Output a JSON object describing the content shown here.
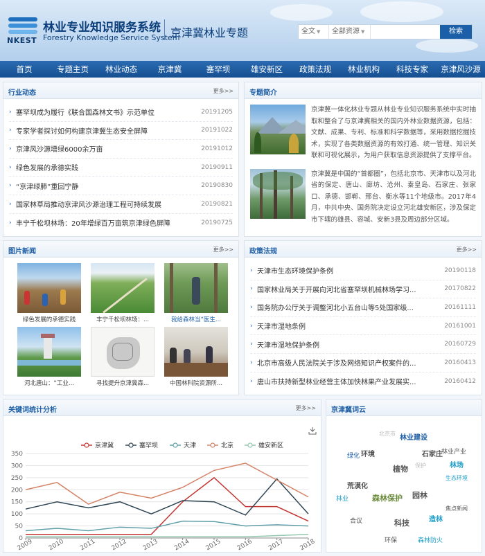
{
  "header": {
    "logo_text": "NKEST",
    "title": "林业专业知识服务系统",
    "subtitle": "Forestry Knowledge Service System",
    "topic": "京津冀林业专题",
    "search": {
      "scope": "全文",
      "resource": "全部资源",
      "button": "检索",
      "value": ""
    }
  },
  "nav": [
    "首页",
    "专题主页",
    "林业动态",
    "京津冀",
    "塞罕坝",
    "雄安新区",
    "政策法规",
    "林业机构",
    "科技专家",
    "京津风沙源"
  ],
  "industry": {
    "title": "行业动态",
    "more": "更多>>",
    "items": [
      {
        "text": "塞罕坝成为履行《联合国森林文书》示范单位",
        "date": "20191205"
      },
      {
        "text": "专家学者探讨如何构建京津冀生态安全屏障",
        "date": "20191022"
      },
      {
        "text": "京津风沙源增绿6000余万亩",
        "date": "20191012"
      },
      {
        "text": "绿色发展的承德实践",
        "date": "20190911"
      },
      {
        "text": "“京津绿肺”重回宁静",
        "date": "20190830"
      },
      {
        "text": "国家林草局推动京津风沙源治理工程可持续发展",
        "date": "20190821"
      },
      {
        "text": "丰宁千松坝林场：20年增绿百万亩筑京津绿色屏障",
        "date": "20190725"
      }
    ]
  },
  "intro": {
    "title": "专题简介",
    "p1": "京津冀一体化林业专题从林业专业知识服务系统中实时抽取和整合了与京津冀相关的国内外林业数据资源，包括：文献、成果、专利、标准和科学数据等，采用数据挖掘技术，实现了各类数据资源的有效打通、统一管理、知识关联和可视化展示，为用户获取信息资源提供了支撑平台。",
    "p2": "京津冀是中国的“首都圈”，包括北京市、天津市以及河北省的保定、唐山、廊坊、沧州、秦皇岛、石家庄、张家口、承德、邯郸、邢台、衡水等11个地级市。2017年4月，中共中央、国务院决定设立河北雄安新区，涉及保定市下辖的雄县、容城、安新3县及周边部分区域。"
  },
  "photos": {
    "title": "图片新闻",
    "more": "更多>>",
    "items": [
      {
        "cap": "绿色发展的承德实践"
      },
      {
        "cap": "丰宁千松坝林场：..."
      },
      {
        "cap": "我给森林当“医生..."
      },
      {
        "cap": "河北唐山：“工业..."
      },
      {
        "cap": "寻找提升京津冀森..."
      },
      {
        "cap": "中国林科院资源所..."
      }
    ]
  },
  "policy": {
    "title": "政策法规",
    "more": "更多>>",
    "items": [
      {
        "text": "天津市生态环境保护条例",
        "date": "20190118"
      },
      {
        "text": "国家林业局关于开展向河北省塞罕坝机械林场学习...",
        "date": "20170822"
      },
      {
        "text": "国务院办公厅关于调整河北小五台山等5处国家级...",
        "date": "20161111"
      },
      {
        "text": "天津市湿地条例",
        "date": "20161001"
      },
      {
        "text": "天津市湿地保护条例",
        "date": "20160729"
      },
      {
        "text": "北京市高级人民法院关于涉及网络知识产权案件的...",
        "date": "20160413"
      },
      {
        "text": "唐山市扶持新型林业经营主体加快林果产业发展实...",
        "date": "20160412"
      }
    ]
  },
  "keyword": {
    "title": "关键词统计分析",
    "more": "更多>>"
  },
  "chart_data": {
    "type": "line",
    "x": [
      "2009",
      "2010",
      "2011",
      "2012",
      "2013",
      "2014",
      "2015",
      "2016",
      "2017",
      "2018"
    ],
    "ylim": [
      0,
      350
    ],
    "yticks": [
      "0",
      "50",
      "100",
      "150",
      "200",
      "250",
      "300",
      "350"
    ],
    "grid": true,
    "legend_position": "top",
    "series": [
      {
        "name": "京津冀",
        "color": "#c23531",
        "values": [
          15,
          15,
          15,
          15,
          15,
          150,
          250,
          130,
          130,
          70
        ]
      },
      {
        "name": "塞罕坝",
        "color": "#2f4554",
        "values": [
          120,
          150,
          125,
          150,
          100,
          155,
          150,
          95,
          245,
          100
        ]
      },
      {
        "name": "天津",
        "color": "#61a0a8",
        "values": [
          30,
          40,
          30,
          45,
          40,
          70,
          68,
          50,
          55,
          50
        ]
      },
      {
        "name": "北京",
        "color": "#d48265",
        "values": [
          200,
          230,
          140,
          190,
          165,
          210,
          280,
          310,
          240,
          170
        ]
      },
      {
        "name": "雄安新区",
        "color": "#91c7ae",
        "values": [
          5,
          5,
          5,
          5,
          5,
          5,
          5,
          5,
          10,
          15
        ]
      }
    ]
  },
  "wordcloud": {
    "title": "京津冀词云",
    "words": [
      {
        "t": "北京市",
        "c": "#bbbbbb"
      },
      {
        "t": "林业建设",
        "c": "#1f5fa6"
      },
      {
        "t": "绿化",
        "c": "#1f5fa6"
      },
      {
        "t": "环境",
        "c": "#555555"
      },
      {
        "t": "石家庄",
        "c": "#555555"
      },
      {
        "t": "林业产业",
        "c": "#555555"
      },
      {
        "t": "林场",
        "c": "#1f9fc9"
      },
      {
        "t": "植物",
        "c": "#555555"
      },
      {
        "t": "保护",
        "c": "#bbbbbb"
      },
      {
        "t": "荒漠化",
        "c": "#555555"
      },
      {
        "t": "生态环境",
        "c": "#1f9fc9"
      },
      {
        "t": "森林保护",
        "c": "#6a8a3a"
      },
      {
        "t": "园林",
        "c": "#555555"
      },
      {
        "t": "林业",
        "c": "#1f9fc9"
      },
      {
        "t": "焦点新闻",
        "c": "#555555"
      },
      {
        "t": "合议",
        "c": "#555555"
      },
      {
        "t": "科技",
        "c": "#555555"
      },
      {
        "t": "造林",
        "c": "#1f9fc9"
      },
      {
        "t": "环保",
        "c": "#555555"
      },
      {
        "t": "森林防火",
        "c": "#1f9fc9"
      }
    ]
  }
}
